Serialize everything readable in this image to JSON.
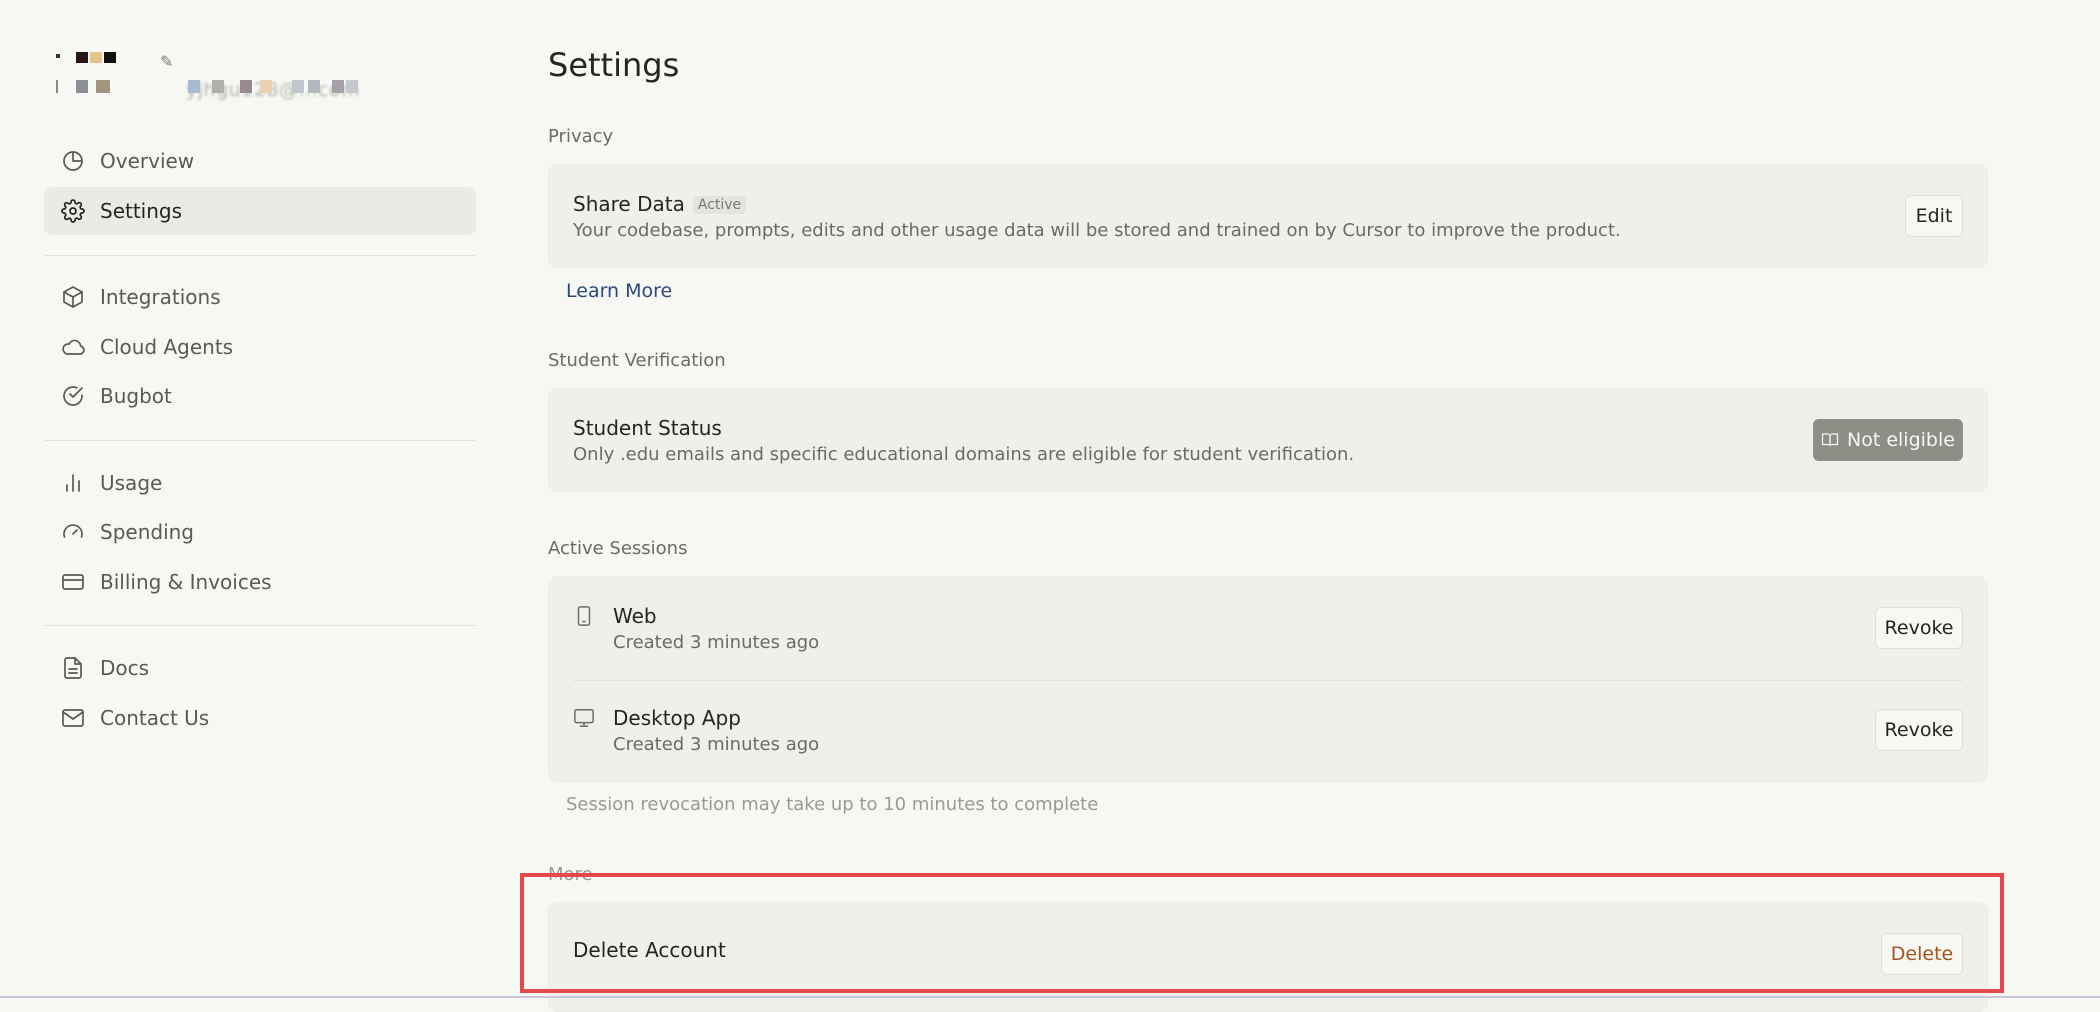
{
  "sidebar": {
    "profile": {
      "email_masked": "yjhgu128@...com"
    },
    "items": [
      {
        "label": "Overview",
        "icon": "pie-chart-icon"
      },
      {
        "label": "Settings",
        "icon": "gear-icon",
        "active": true
      },
      {
        "label": "Integrations",
        "icon": "cube-icon"
      },
      {
        "label": "Cloud Agents",
        "icon": "cloud-icon"
      },
      {
        "label": "Bugbot",
        "icon": "check-circle-icon"
      },
      {
        "label": "Usage",
        "icon": "bar-chart-icon"
      },
      {
        "label": "Spending",
        "icon": "gauge-icon"
      },
      {
        "label": "Billing & Invoices",
        "icon": "credit-card-icon"
      },
      {
        "label": "Docs",
        "icon": "document-icon"
      },
      {
        "label": "Contact Us",
        "icon": "mail-icon"
      }
    ]
  },
  "main": {
    "title": "Settings",
    "privacy": {
      "label": "Privacy",
      "share_title": "Share Data",
      "share_badge": "Active",
      "share_desc": "Your codebase, prompts, edits and other usage data will be stored and trained on by Cursor to improve the product.",
      "edit_button": "Edit",
      "learn_more": "Learn More"
    },
    "student": {
      "label": "Student Verification",
      "title": "Student Status",
      "desc": "Only .edu emails and specific educational domains are eligible for student verification.",
      "status_button": "Not eligible"
    },
    "sessions": {
      "label": "Active Sessions",
      "items": [
        {
          "name": "Web",
          "created": "Created 3 minutes ago",
          "icon": "phone-icon",
          "action": "Revoke"
        },
        {
          "name": "Desktop App",
          "created": "Created 3 minutes ago",
          "icon": "monitor-icon",
          "action": "Revoke"
        }
      ],
      "note": "Session revocation may take up to 10 minutes to complete"
    },
    "more": {
      "label": "More",
      "delete_title": "Delete Account",
      "delete_button": "Delete"
    }
  },
  "colors": {
    "background": "#f7f7f4",
    "card": "#f0efea",
    "highlight": "#e5484d",
    "link": "#2a4a7a",
    "danger_text": "#a5541e"
  }
}
